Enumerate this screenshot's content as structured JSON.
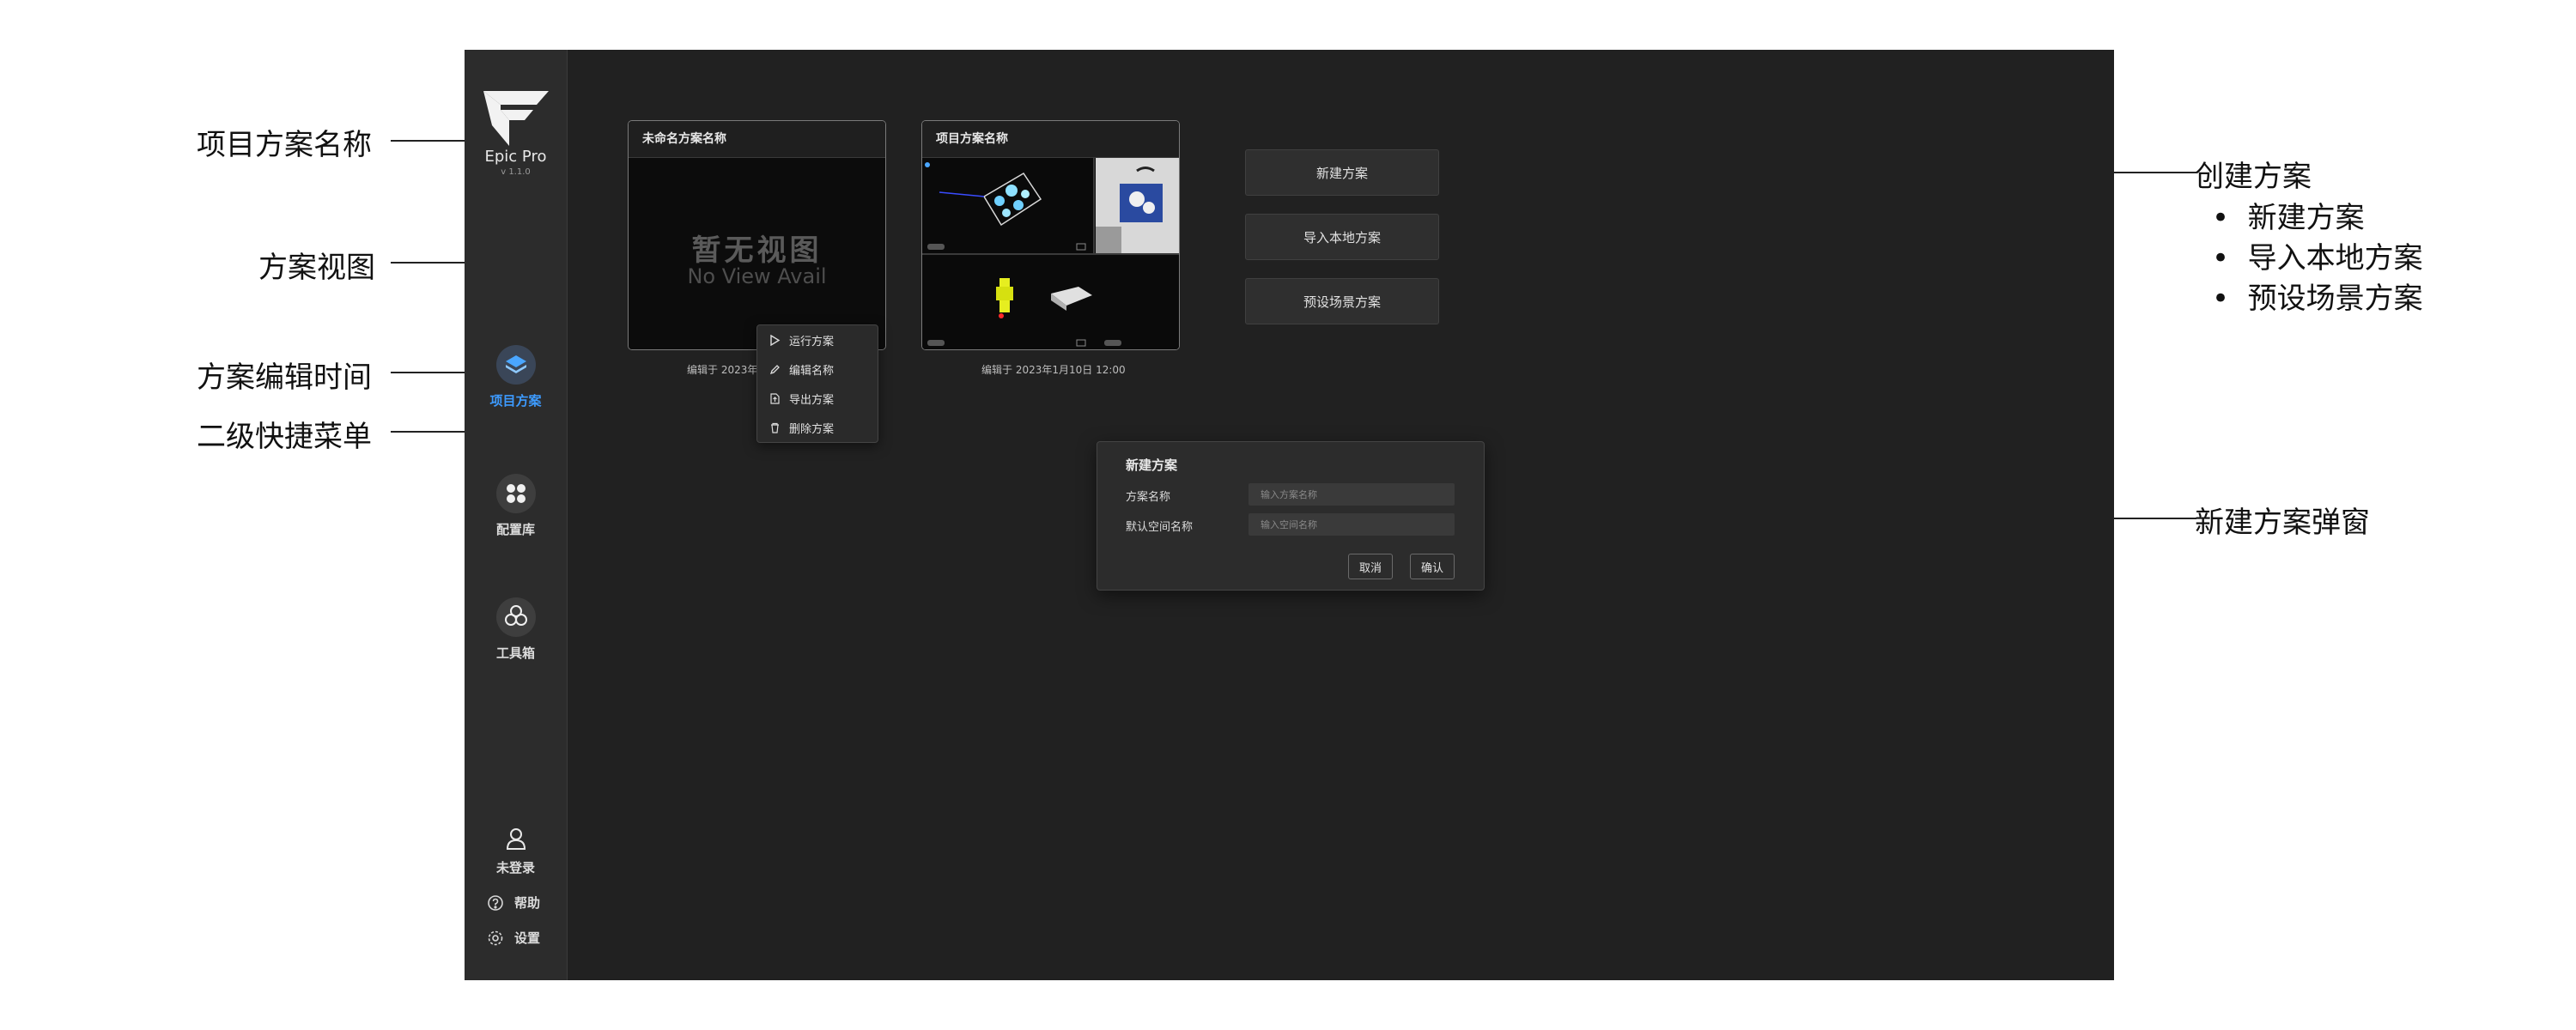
{
  "brand": {
    "name": "Epic Pro",
    "version": "v 1.1.0"
  },
  "nav": [
    {
      "label": "项目方案",
      "icon": "layers-icon"
    },
    {
      "label": "配置库",
      "icon": "grid-dots-icon"
    },
    {
      "label": "工具箱",
      "icon": "flower-icon"
    }
  ],
  "user": {
    "login_label": "未登录",
    "help_label": "帮助",
    "settings_label": "设置"
  },
  "cards": [
    {
      "title": "未命名方案名称",
      "noview_cn": "暂无视图",
      "noview_en": "No View Avail",
      "time": "编辑于 2023年"
    },
    {
      "title": "项目方案名称",
      "time": "编辑于 2023年1月10日 12:00"
    }
  ],
  "context_menu": [
    "运行方案",
    "编辑名称",
    "导出方案",
    "删除方案"
  ],
  "create_buttons": [
    "新建方案",
    "导入本地方案",
    "预设场景方案"
  ],
  "dialog": {
    "title": "新建方案",
    "name_label": "方案名称",
    "name_placeholder": "输入方案名称",
    "space_label": "默认空间名称",
    "space_placeholder": "输入空间名称",
    "cancel_label": "取消",
    "confirm_label": "确认"
  },
  "annotations": {
    "project_name": "项目方案名称",
    "view": "方案视图",
    "edit_time": "方案编辑时间",
    "submenu": "二级快捷菜单",
    "create": "创建方案",
    "create_items": [
      "新建方案",
      "导入本地方案",
      "预设场景方案"
    ],
    "dialog": "新建方案弹窗"
  },
  "colors": {
    "app_bg": "#212121",
    "sidebar_bg": "#2c2c2c",
    "accent": "#3d9bff"
  }
}
